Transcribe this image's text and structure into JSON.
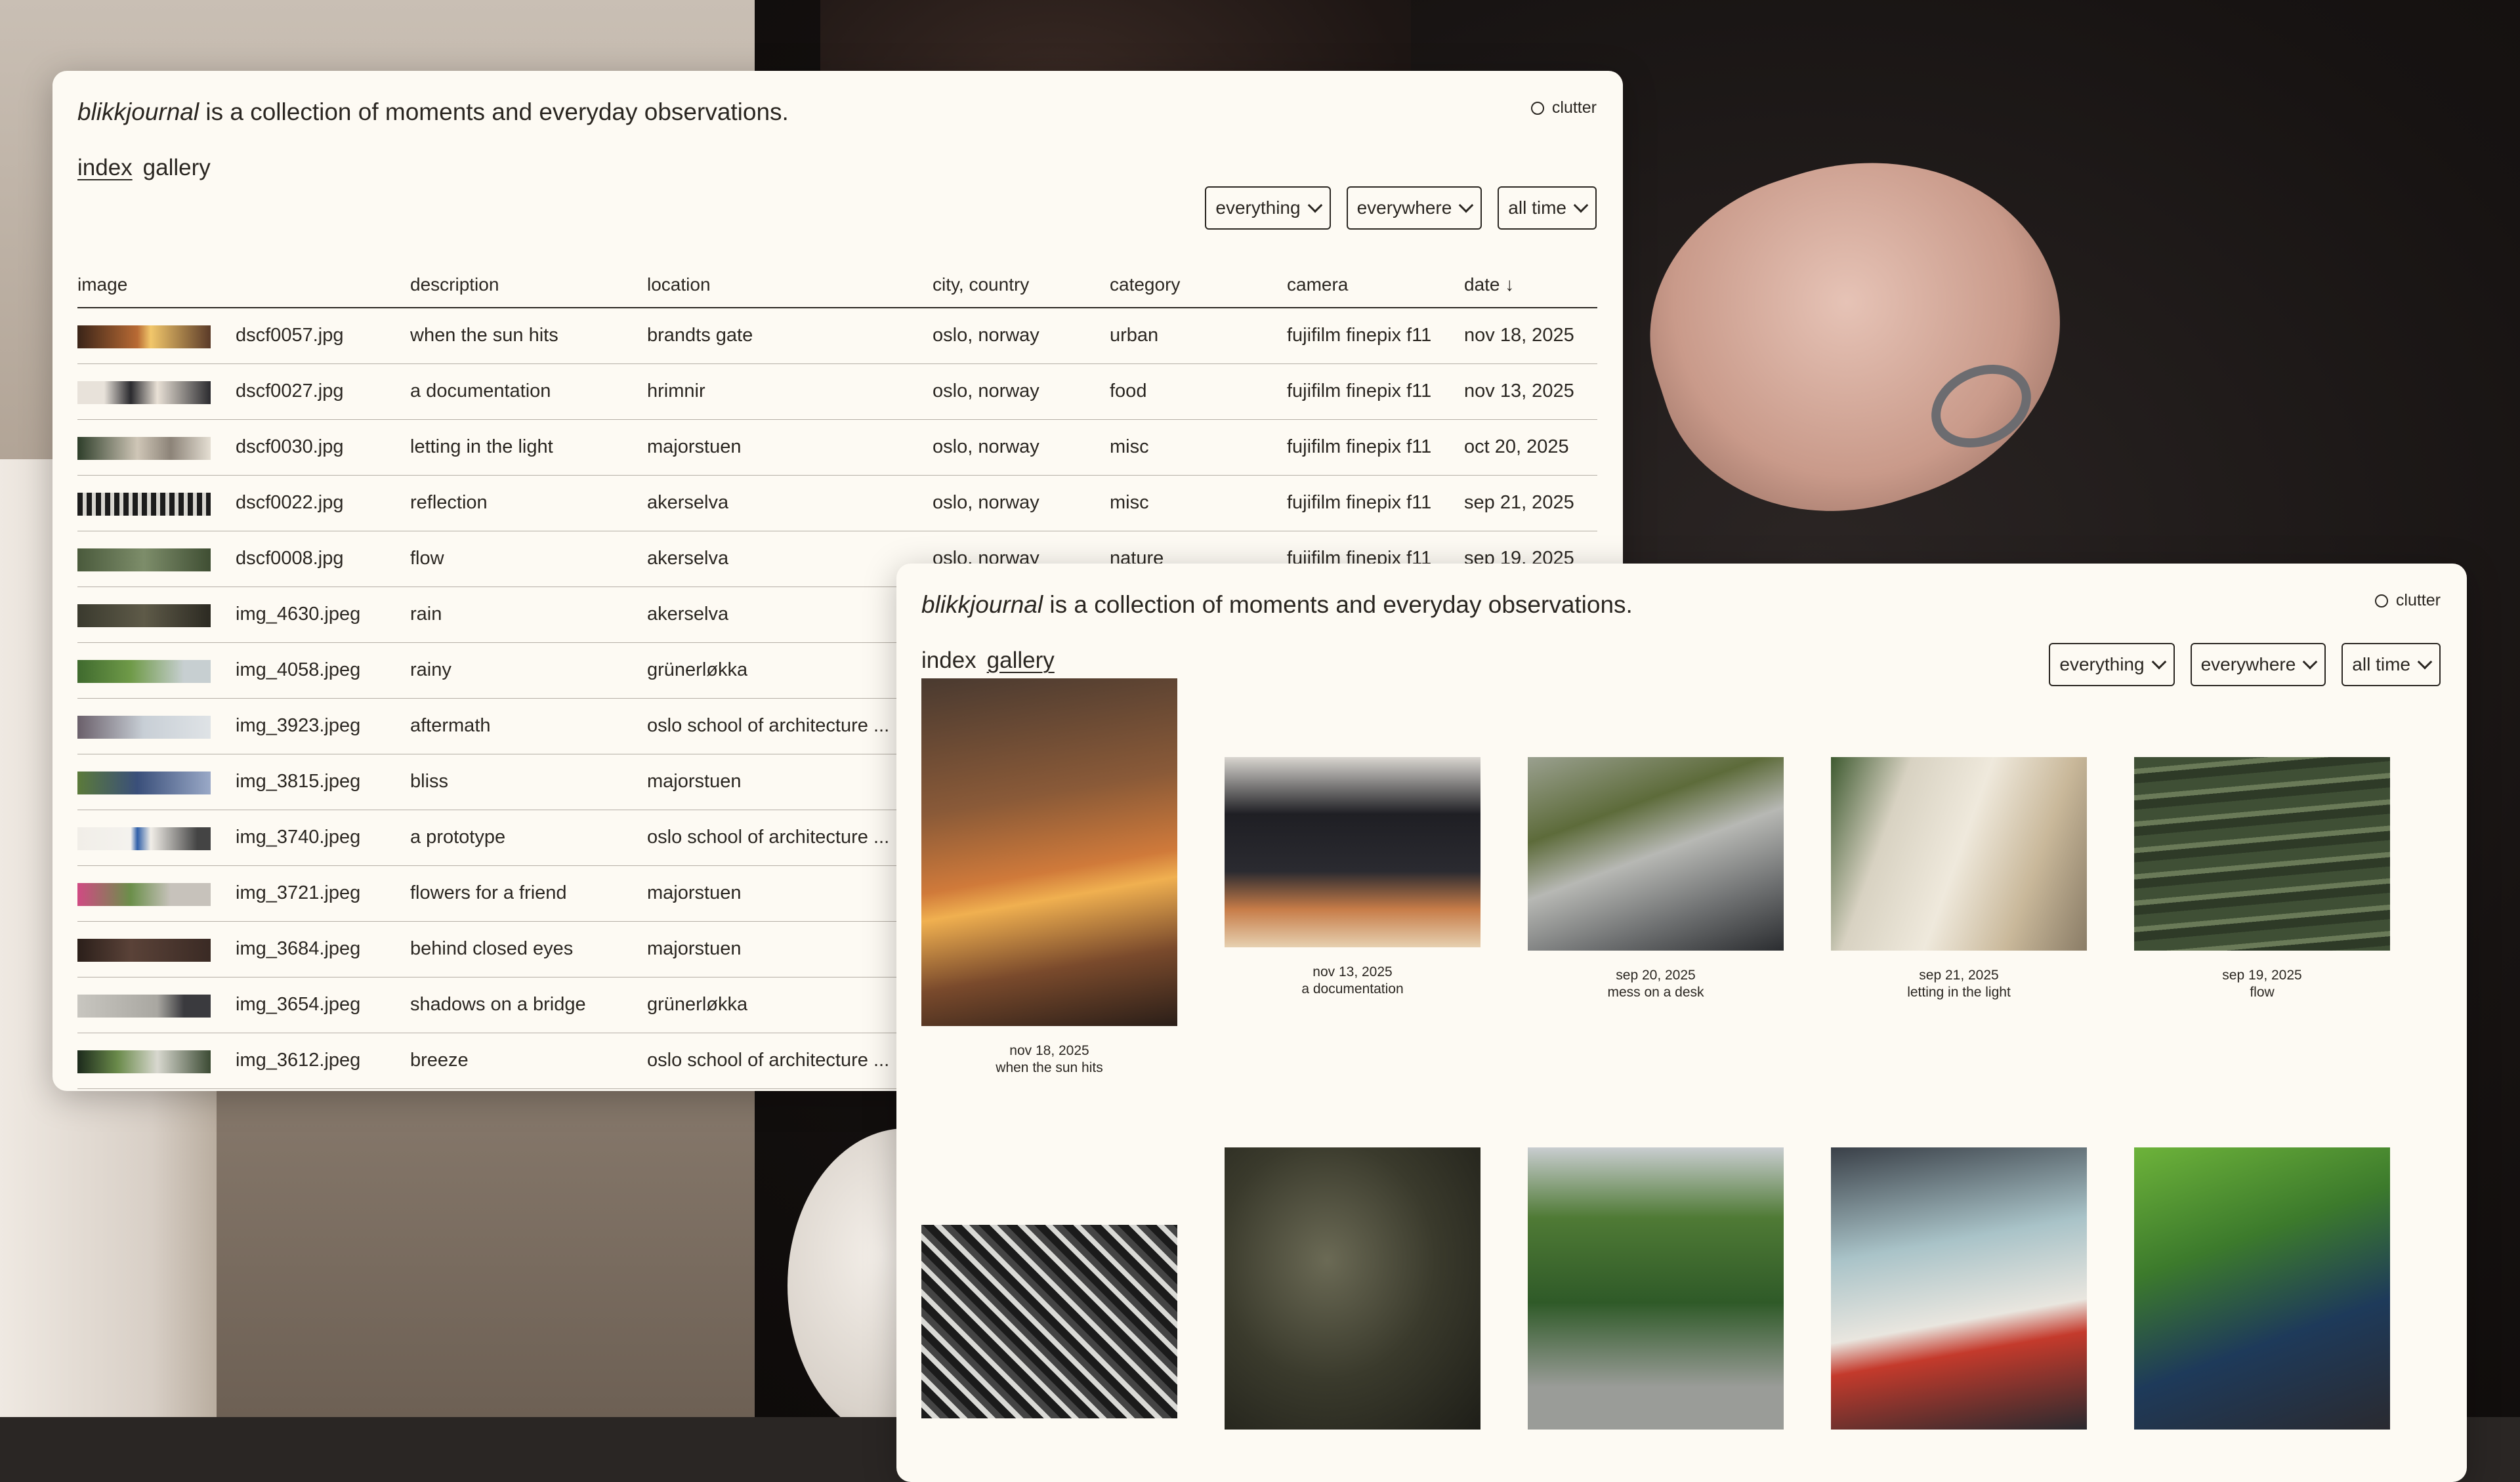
{
  "site": {
    "name": "blikkjournal",
    "tagline": " is a collection of moments and everyday observations.",
    "toggle_label": "clutter"
  },
  "nav": {
    "index": "index",
    "gallery": "gallery"
  },
  "filters": {
    "what": "everything",
    "where": "everywhere",
    "when": "all time"
  },
  "table": {
    "headers": {
      "image": "image",
      "description": "description",
      "location": "location",
      "city": "city, country",
      "category": "category",
      "camera": "camera",
      "date": "date ↓"
    },
    "rows": [
      {
        "file": "dscf0057.jpg",
        "desc": "when the sun hits",
        "loc": "brandts gate",
        "city": "oslo, norway",
        "cat": "urban",
        "cam": "fujifilm finepix f11",
        "date": "nov 18, 2025"
      },
      {
        "file": "dscf0027.jpg",
        "desc": "a documentation",
        "loc": "hrimnir",
        "city": "oslo, norway",
        "cat": "food",
        "cam": "fujifilm finepix f11",
        "date": "nov 13, 2025"
      },
      {
        "file": "dscf0030.jpg",
        "desc": "letting in the light",
        "loc": "majorstuen",
        "city": "oslo, norway",
        "cat": "misc",
        "cam": "fujifilm finepix f11",
        "date": "oct 20, 2025"
      },
      {
        "file": "dscf0022.jpg",
        "desc": "reflection",
        "loc": "akerselva",
        "city": "oslo, norway",
        "cat": "misc",
        "cam": "fujifilm finepix f11",
        "date": "sep 21, 2025"
      },
      {
        "file": "dscf0008.jpg",
        "desc": "flow",
        "loc": "akerselva",
        "city": "oslo, norway",
        "cat": "nature",
        "cam": "fujifilm finepix f11",
        "date": "sep 19, 2025"
      },
      {
        "file": "img_4630.jpeg",
        "desc": "rain",
        "loc": "akerselva",
        "city": "",
        "cat": "",
        "cam": "",
        "date": ""
      },
      {
        "file": "img_4058.jpeg",
        "desc": "rainy",
        "loc": "grünerløkka",
        "city": "",
        "cat": "",
        "cam": "",
        "date": ""
      },
      {
        "file": "img_3923.jpeg",
        "desc": "aftermath",
        "loc": "oslo school of architecture ...",
        "city": "",
        "cat": "",
        "cam": "",
        "date": ""
      },
      {
        "file": "img_3815.jpeg",
        "desc": "bliss",
        "loc": "majorstuen",
        "city": "",
        "cat": "",
        "cam": "",
        "date": ""
      },
      {
        "file": "img_3740.jpeg",
        "desc": "a prototype",
        "loc": "oslo school of architecture ...",
        "city": "",
        "cat": "",
        "cam": "",
        "date": ""
      },
      {
        "file": "img_3721.jpeg",
        "desc": "flowers for a friend",
        "loc": "majorstuen",
        "city": "",
        "cat": "",
        "cam": "",
        "date": ""
      },
      {
        "file": "img_3684.jpeg",
        "desc": "behind closed eyes",
        "loc": "majorstuen",
        "city": "",
        "cat": "",
        "cam": "",
        "date": ""
      },
      {
        "file": "img_3654.jpeg",
        "desc": "shadows on a bridge",
        "loc": "grünerløkka",
        "city": "",
        "cat": "",
        "cam": "",
        "date": ""
      },
      {
        "file": "img_3612.jpeg",
        "desc": "breeze",
        "loc": "oslo school of architecture ...",
        "city": "",
        "cat": "",
        "cam": "",
        "date": ""
      }
    ]
  },
  "gallery": {
    "items": [
      {
        "date": "nov 18, 2025",
        "desc": "when the sun hits"
      },
      {
        "date": "nov 13, 2025",
        "desc": "a documentation"
      },
      {
        "date": "sep 20, 2025",
        "desc": "mess on a desk"
      },
      {
        "date": "sep 21, 2025",
        "desc": "letting in the light"
      },
      {
        "date": "sep 19, 2025",
        "desc": "flow"
      },
      {
        "date": "",
        "desc": ""
      },
      {
        "date": "",
        "desc": ""
      },
      {
        "date": "",
        "desc": ""
      },
      {
        "date": "",
        "desc": ""
      },
      {
        "date": "",
        "desc": ""
      }
    ]
  },
  "colors": {
    "panel_bg": "#fdfaf3",
    "text": "#2a2621",
    "rule": "#b5afa6"
  }
}
